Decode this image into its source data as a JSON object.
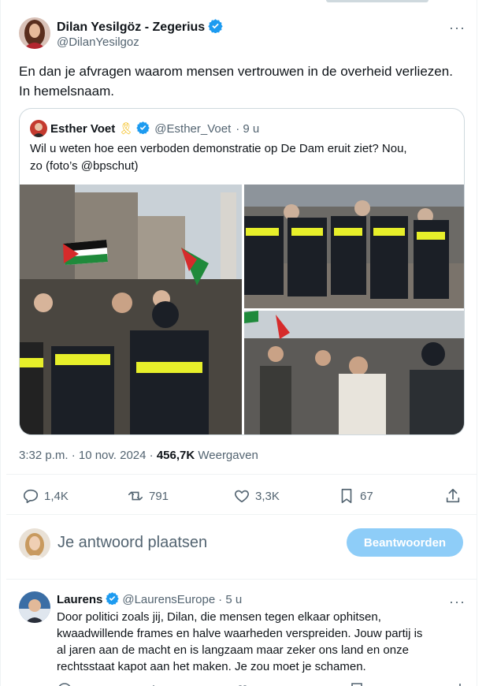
{
  "tweet": {
    "author_name": "Dilan Yesilgöz - Zegerius",
    "handle": "@DilanYesilgoz",
    "text_lines": [
      "En dan je afvragen waarom mensen vertrouwen in de overheid verliezen.",
      "In hemelsnaam."
    ],
    "more_icon": "more-icon",
    "verified_icon": "verified-badge-icon"
  },
  "quoted": {
    "author_name": "Esther Voet",
    "ribbon_emoji": "🎗",
    "handle": "@Esther_Voet",
    "time": "· 9 u",
    "text_lines": [
      "Wil u weten hoe een verboden demonstratie op De Dam eruit ziet? Nou,",
      "zo (foto’s @bpschut)"
    ]
  },
  "stats": {
    "timestamp": "3:32 p.m. · 10 nov. 2024 · ",
    "views_count": "456,7K",
    "views_label": " Weergaven"
  },
  "actions": {
    "replies": "1,4K",
    "reposts": "791",
    "likes": "3,3K",
    "bookmarks": "67"
  },
  "composer": {
    "placeholder": "Je antwoord plaatsen",
    "button": "Beantwoorden"
  },
  "reply": {
    "author_name": "Laurens",
    "handle": "@LaurensEurope",
    "time": "· 5 u",
    "text_lines": [
      "Door politici zoals jij, Dilan, die mensen tegen elkaar ophitsen,",
      "kwaadwillende frames en halve waarheden verspreiden. Jouw partij is",
      "al jaren aan de macht en is langzaam maar zeker ons land en onze",
      "rechtsstaat kapot aan het maken. Je zou moet je schamen."
    ],
    "more_icon": "more-icon"
  },
  "colors": {
    "accent": "#1d9bf0",
    "secondary_text": "#536471",
    "button_disabled": "#8ecdf8"
  }
}
